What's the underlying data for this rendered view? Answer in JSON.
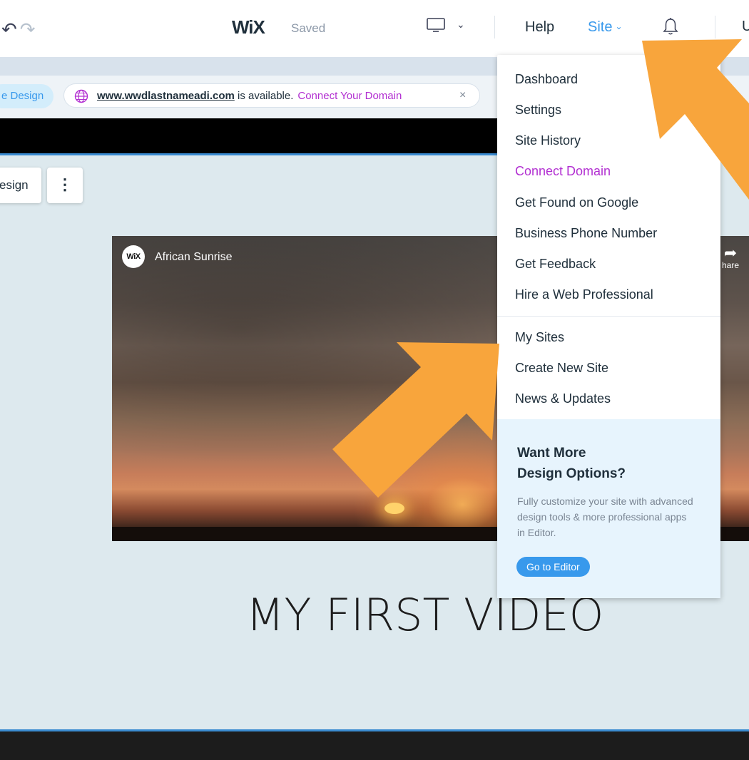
{
  "topbar": {
    "logo": "WiX",
    "status": "Saved",
    "device_chevron": "⌄",
    "help": "Help",
    "site_menu": "Site",
    "site_chevron": "⌄",
    "user_initial_cut": "U"
  },
  "notification": {
    "design_pill": "e Design",
    "domain": "www.wwdlastnameadi.com",
    "domain_suffix": " is available.",
    "connect_label": "Connect Your Domain",
    "close": "×"
  },
  "toolbar": {
    "design_label": "esign",
    "more_label": "⋮"
  },
  "video": {
    "badge": "WiX",
    "title": "African Sunrise",
    "share_label": "hare"
  },
  "page": {
    "headline": "MY FIRST VIDEO"
  },
  "site_dropdown": {
    "items_top": [
      {
        "label": "Dashboard"
      },
      {
        "label": "Settings"
      },
      {
        "label": "Site History"
      },
      {
        "label": "Connect Domain"
      },
      {
        "label": "Get Found on Google"
      },
      {
        "label": "Business Phone Number"
      },
      {
        "label": "Get Feedback"
      },
      {
        "label": "Hire a Web Professional"
      }
    ],
    "items_bottom": [
      {
        "label": "My Sites"
      },
      {
        "label": "Create New Site"
      },
      {
        "label": "News & Updates"
      }
    ],
    "promo": {
      "title_line1": "Want More",
      "title_line2": "Design Options?",
      "text": "Fully customize your site with advanced design tools & more professional apps in Editor.",
      "button": "Go to Editor"
    }
  },
  "colors": {
    "accent_blue": "#3899ec",
    "connect_purple": "#b22fd1",
    "arrow_orange": "#f8a53c",
    "promo_bg": "#e7f4fd"
  }
}
